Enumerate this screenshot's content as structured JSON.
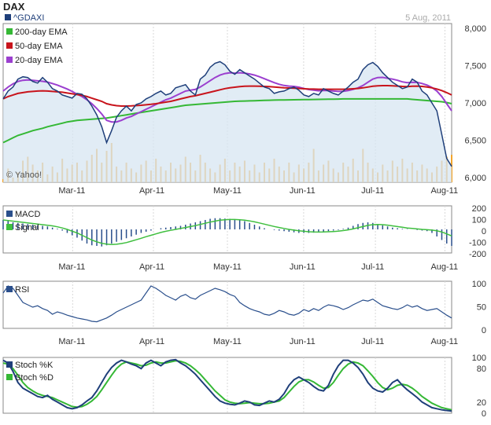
{
  "header": {
    "title": "DAX",
    "symbol": "^GDAXI",
    "date": "5 Aug, 2011",
    "watermark": "© Yahoo!"
  },
  "colors": {
    "price_line": "#1f3f7a",
    "price_fill": "#d7e6f2",
    "ema200": "#35b835",
    "ema50": "#c8141c",
    "ema20": "#9b3fcf",
    "volume": "#f2a42c",
    "macd": "#2a4f8c",
    "signal": "#3fbf3f",
    "rsi": "#2a4f8c",
    "stoch_k": "#1f3f7a",
    "stoch_d": "#35b835",
    "frame": "#888888"
  },
  "x_axis": {
    "months": [
      "Mar-11",
      "Apr-11",
      "May-11",
      "Jun-11",
      "Jul-11",
      "Aug-11"
    ]
  },
  "chart_data": [
    {
      "type": "line",
      "panel": "price",
      "y_ticks": [
        "8,000",
        "7,500",
        "7,000",
        "6,500",
        "6,000"
      ],
      "ylim": [
        6000,
        8000
      ],
      "series": [
        {
          "name": "^GDAXI",
          "values": [
            7050,
            7150,
            7200,
            7300,
            7330,
            7320,
            7270,
            7250,
            7320,
            7260,
            7180,
            7150,
            7100,
            7080,
            7060,
            7120,
            7110,
            7050,
            6960,
            6850,
            6700,
            6500,
            6650,
            6820,
            6900,
            6960,
            6900,
            6980,
            7000,
            7050,
            7080,
            7120,
            7150,
            7100,
            7120,
            7190,
            7210,
            7230,
            7150,
            7100,
            7300,
            7350,
            7450,
            7500,
            7520,
            7480,
            7400,
            7360,
            7420,
            7380,
            7340,
            7300,
            7250,
            7200,
            7180,
            7120,
            7140,
            7150,
            7180,
            7200,
            7160,
            7100,
            7080,
            7120,
            7100,
            7180,
            7150,
            7120,
            7100,
            7150,
            7200,
            7260,
            7300,
            7420,
            7480,
            7510,
            7460,
            7380,
            7320,
            7260,
            7220,
            7180,
            7200,
            7300,
            7260,
            7150,
            7100,
            7000,
            6900,
            6600,
            6300,
            6200
          ]
        },
        {
          "name": "200-day EMA",
          "values": [
            6500,
            6530,
            6560,
            6590,
            6610,
            6630,
            6650,
            6665,
            6680,
            6700,
            6715,
            6730,
            6745,
            6760,
            6770,
            6780,
            6785,
            6790,
            6795,
            6800,
            6805,
            6810,
            6820,
            6830,
            6840,
            6850,
            6860,
            6870,
            6880,
            6890,
            6900,
            6910,
            6920,
            6930,
            6940,
            6950,
            6960,
            6970,
            6975,
            6980,
            6985,
            6990,
            6995,
            7000,
            7005,
            7010,
            7015,
            7020,
            7022,
            7024,
            7026,
            7028,
            7030,
            7032,
            7034,
            7036,
            7037,
            7038,
            7039,
            7040,
            7041,
            7042,
            7043,
            7044,
            7045,
            7046,
            7047,
            7048,
            7049,
            7050,
            7050,
            7050,
            7050,
            7050,
            7050,
            7050,
            7050,
            7050,
            7050,
            7050,
            7050,
            7050,
            7050,
            7045,
            7040,
            7035,
            7030,
            7025,
            7020,
            7015,
            7005,
            6990
          ]
        },
        {
          "name": "50-day EMA",
          "values": [
            7050,
            7080,
            7100,
            7120,
            7130,
            7140,
            7145,
            7150,
            7152,
            7150,
            7145,
            7140,
            7135,
            7125,
            7115,
            7105,
            7095,
            7080,
            7060,
            7040,
            7020,
            6990,
            6975,
            6965,
            6960,
            6960,
            6962,
            6966,
            6970,
            6976,
            6982,
            6990,
            7000,
            7010,
            7020,
            7035,
            7050,
            7065,
            7080,
            7090,
            7105,
            7120,
            7135,
            7150,
            7165,
            7180,
            7190,
            7198,
            7205,
            7210,
            7212,
            7212,
            7210,
            7208,
            7205,
            7200,
            7195,
            7190,
            7188,
            7185,
            7182,
            7178,
            7175,
            7174,
            7172,
            7172,
            7172,
            7172,
            7172,
            7172,
            7174,
            7178,
            7182,
            7190,
            7200,
            7210,
            7215,
            7218,
            7218,
            7216,
            7212,
            7208,
            7206,
            7210,
            7212,
            7208,
            7200,
            7190,
            7175,
            7155,
            7130,
            7100
          ]
        },
        {
          "name": "20-day EMA",
          "values": [
            7150,
            7200,
            7240,
            7270,
            7285,
            7290,
            7285,
            7278,
            7272,
            7262,
            7245,
            7225,
            7200,
            7175,
            7145,
            7110,
            7080,
            7040,
            6990,
            6930,
            6860,
            6780,
            6760,
            6760,
            6780,
            6810,
            6830,
            6860,
            6890,
            6920,
            6950,
            6980,
            7010,
            7040,
            7060,
            7090,
            7120,
            7150,
            7160,
            7170,
            7200,
            7240,
            7280,
            7320,
            7350,
            7370,
            7380,
            7375,
            7380,
            7375,
            7365,
            7350,
            7330,
            7305,
            7280,
            7255,
            7235,
            7220,
            7212,
            7208,
            7198,
            7182,
            7168,
            7160,
            7152,
            7156,
            7155,
            7150,
            7145,
            7146,
            7155,
            7170,
            7190,
            7220,
            7260,
            7300,
            7320,
            7322,
            7310,
            7300,
            7285,
            7265,
            7255,
            7260,
            7258,
            7245,
            7225,
            7195,
            7150,
            7080,
            6990,
            6900
          ]
        }
      ],
      "volume_values": [
        0.08,
        0.35,
        0.12,
        0.25,
        0.55,
        0.65,
        0.45,
        0.3,
        0.5,
        0.2,
        0.4,
        0.25,
        0.6,
        0.35,
        0.45,
        0.5,
        0.3,
        0.55,
        0.7,
        0.85,
        0.5,
        0.8,
        1.0,
        0.4,
        0.3,
        0.5,
        0.35,
        0.25,
        0.45,
        0.55,
        0.3,
        0.6,
        0.4,
        0.3,
        0.5,
        0.35,
        0.45,
        0.65,
        0.5,
        0.3,
        0.7,
        0.5,
        0.35,
        0.25,
        0.45,
        0.6,
        0.3,
        0.5,
        0.4,
        0.55,
        0.3,
        0.45,
        0.25,
        0.5,
        0.35,
        0.6,
        0.4,
        0.3,
        0.5,
        0.25,
        0.45,
        0.35,
        0.5,
        0.85,
        0.3,
        0.45,
        0.55,
        0.35,
        0.25,
        0.5,
        0.4,
        0.6,
        0.3,
        0.85,
        0.5,
        0.35,
        0.25,
        0.45,
        0.3,
        0.55,
        0.4,
        0.6,
        0.35,
        0.5,
        0.3,
        0.45,
        0.35,
        0.25,
        0.4,
        0.55,
        0.65,
        0.7
      ]
    },
    {
      "type": "bar",
      "panel": "macd",
      "y_ticks": [
        "200",
        "100",
        "0",
        "-100",
        "-200"
      ],
      "ylim": [
        -200,
        200
      ],
      "series": [
        {
          "name": "MACD",
          "values": [
            80,
            70,
            60,
            55,
            50,
            45,
            40,
            35,
            30,
            25,
            15,
            5,
            -10,
            -30,
            -50,
            -70,
            -95,
            -120,
            -135,
            -140,
            -145,
            -135,
            -120,
            -105,
            -90,
            -75,
            -60,
            -45,
            -30,
            -20,
            -10,
            0,
            10,
            15,
            20,
            25,
            30,
            40,
            50,
            60,
            70,
            80,
            90,
            95,
            95,
            92,
            90,
            85,
            80,
            70,
            55,
            40,
            25,
            10,
            0,
            -5,
            -10,
            -15,
            -20,
            -25,
            -30,
            -30,
            -30,
            -28,
            -25,
            -20,
            -15,
            -10,
            -5,
            5,
            15,
            30,
            45,
            55,
            60,
            55,
            45,
            35,
            25,
            15,
            10,
            5,
            3,
            0,
            -5,
            -10,
            -15,
            -30,
            -60,
            -90,
            -120,
            -140
          ]
        },
        {
          "name": "Signal",
          "values": [
            80,
            75,
            70,
            65,
            60,
            55,
            50,
            45,
            40,
            35,
            30,
            22,
            12,
            0,
            -15,
            -30,
            -50,
            -70,
            -90,
            -105,
            -118,
            -125,
            -128,
            -126,
            -120,
            -112,
            -100,
            -88,
            -75,
            -62,
            -50,
            -38,
            -26,
            -16,
            -8,
            0,
            8,
            16,
            24,
            32,
            42,
            52,
            62,
            70,
            78,
            82,
            84,
            84,
            82,
            78,
            72,
            64,
            55,
            45,
            35,
            25,
            16,
            8,
            0,
            -6,
            -12,
            -16,
            -20,
            -22,
            -23,
            -22,
            -20,
            -18,
            -15,
            -10,
            -4,
            4,
            14,
            24,
            34,
            40,
            42,
            40,
            36,
            30,
            24,
            18,
            12,
            8,
            4,
            0,
            -3,
            -6,
            -12,
            -22,
            -38,
            -55
          ]
        }
      ]
    },
    {
      "type": "line",
      "panel": "rsi",
      "y_ticks": [
        "100",
        "50",
        "0"
      ],
      "ylim": [
        0,
        100
      ],
      "series": [
        {
          "name": "RSI",
          "values": [
            75,
            90,
            85,
            70,
            55,
            50,
            45,
            48,
            42,
            38,
            30,
            35,
            32,
            28,
            25,
            22,
            20,
            18,
            15,
            14,
            18,
            22,
            28,
            35,
            40,
            45,
            50,
            55,
            60,
            75,
            90,
            85,
            78,
            70,
            65,
            60,
            68,
            72,
            65,
            62,
            70,
            75,
            80,
            85,
            82,
            78,
            72,
            68,
            55,
            48,
            42,
            38,
            35,
            30,
            28,
            32,
            38,
            35,
            30,
            28,
            32,
            40,
            36,
            42,
            38,
            45,
            50,
            48,
            45,
            40,
            44,
            50,
            55,
            60,
            58,
            62,
            55,
            48,
            45,
            42,
            40,
            44,
            50,
            45,
            48,
            42,
            38,
            40,
            42,
            35,
            28,
            22
          ]
        }
      ]
    },
    {
      "type": "line",
      "panel": "stochastic",
      "y_ticks": [
        "100",
        "80",
        "20",
        "0"
      ],
      "ylim": [
        0,
        100
      ],
      "series": [
        {
          "name": "Stoch %K",
          "values": [
            95,
            90,
            75,
            55,
            45,
            40,
            35,
            30,
            28,
            32,
            25,
            20,
            15,
            10,
            8,
            10,
            15,
            22,
            28,
            40,
            55,
            70,
            82,
            90,
            95,
            92,
            88,
            85,
            80,
            90,
            95,
            90,
            85,
            92,
            95,
            96,
            90,
            85,
            78,
            70,
            60,
            50,
            40,
            30,
            22,
            18,
            16,
            15,
            18,
            22,
            20,
            15,
            14,
            18,
            22,
            20,
            25,
            35,
            50,
            60,
            65,
            60,
            55,
            48,
            42,
            40,
            50,
            70,
            85,
            95,
            95,
            90,
            82,
            70,
            55,
            45,
            40,
            38,
            45,
            55,
            60,
            50,
            42,
            35,
            28,
            20,
            15,
            10,
            8,
            6,
            5,
            4
          ]
        },
        {
          "name": "Stoch %D",
          "values": [
            90,
            88,
            80,
            68,
            55,
            46,
            40,
            35,
            32,
            30,
            28,
            24,
            20,
            16,
            12,
            11,
            12,
            16,
            22,
            30,
            42,
            55,
            68,
            80,
            88,
            92,
            90,
            88,
            85,
            86,
            90,
            92,
            90,
            90,
            92,
            94,
            93,
            90,
            85,
            78,
            70,
            60,
            50,
            40,
            32,
            24,
            20,
            18,
            17,
            18,
            19,
            18,
            17,
            17,
            18,
            20,
            22,
            28,
            38,
            48,
            56,
            60,
            60,
            56,
            50,
            45,
            46,
            55,
            68,
            80,
            88,
            92,
            90,
            85,
            76,
            66,
            55,
            46,
            42,
            45,
            50,
            52,
            50,
            45,
            38,
            30,
            24,
            18,
            14,
            10,
            8,
            6
          ]
        }
      ]
    }
  ]
}
